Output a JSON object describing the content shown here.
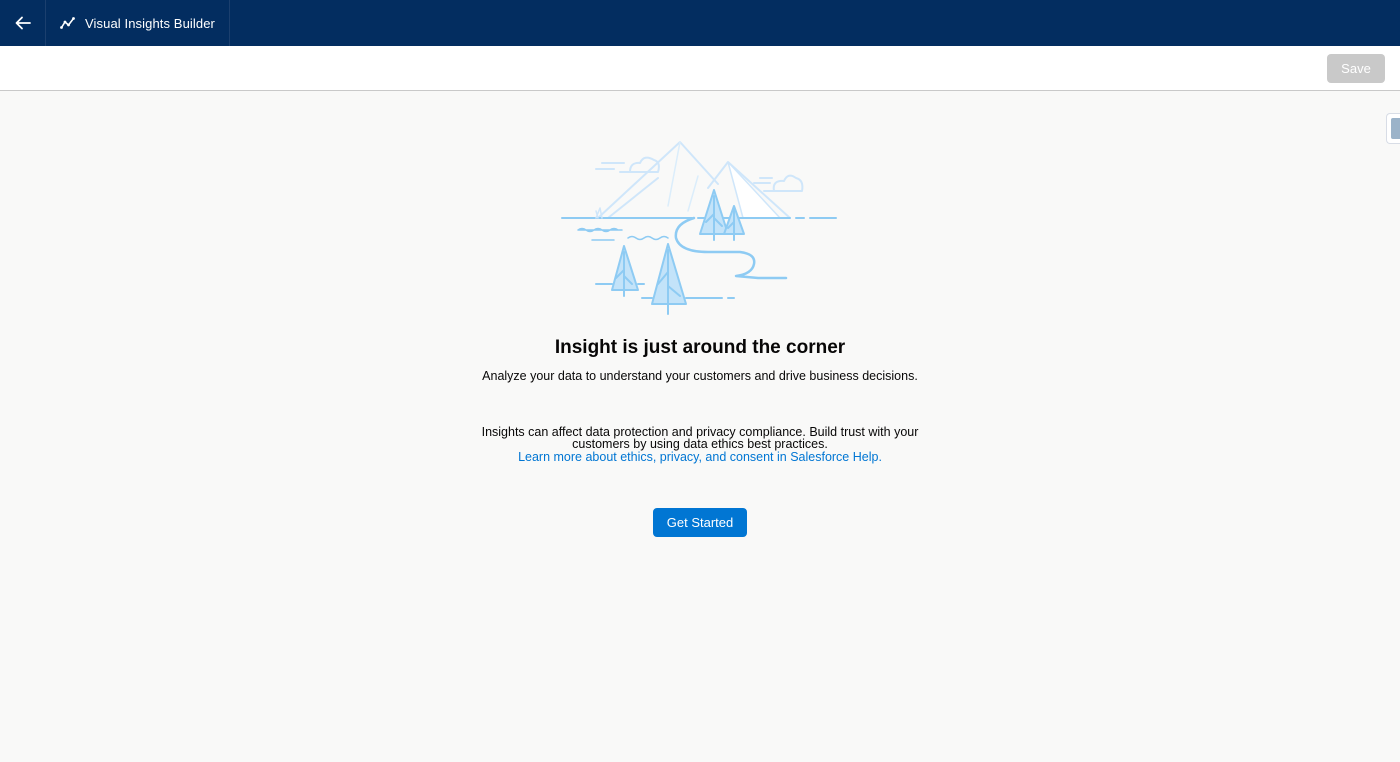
{
  "header": {
    "app_title": "Visual Insights Builder",
    "back_icon": "arrow-left-icon",
    "app_icon": "line-chart-icon"
  },
  "toolbar": {
    "save_label": "Save"
  },
  "empty_state": {
    "illustration": "mountains-trees-illustration",
    "heading": "Insight is just around the corner",
    "subtext": "Analyze your data to understand your customers and drive business decisions.",
    "privacy_text": "Insights can affect data protection and privacy compliance. Build trust with your customers by using data ethics best practices.",
    "help_link": "Learn more about ethics, privacy, and consent in Salesforce Help.",
    "cta_label": "Get Started"
  },
  "colors": {
    "header_bg": "#032d60",
    "brand_button": "#0176d3",
    "link": "#0176d3",
    "disabled_button": "#c9c9c9",
    "illustration_stroke": "#8ecbf3",
    "illustration_fill": "#c3e3f9"
  }
}
